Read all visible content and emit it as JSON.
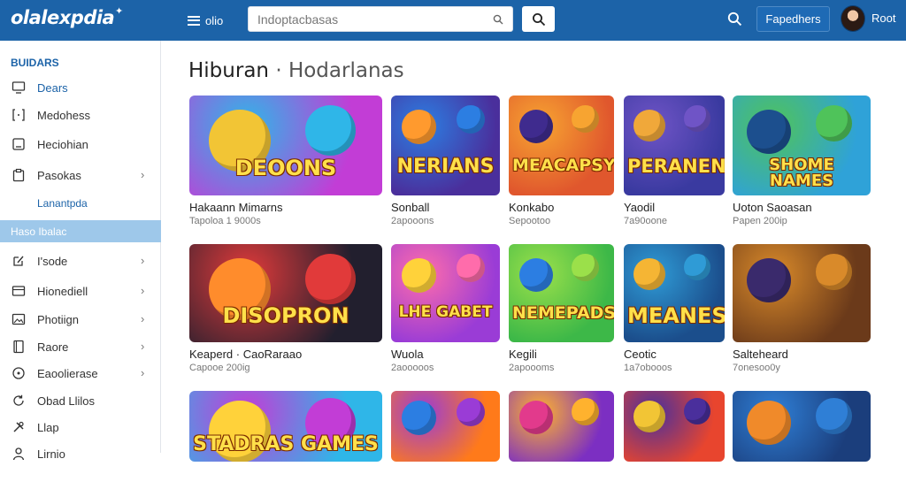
{
  "header": {
    "logo": "olalexpdia",
    "menu_label": "olio",
    "search_placeholder": "Indoptacbasas",
    "favorites_label": "Fapedhers",
    "user_name": "Root"
  },
  "sidebar": {
    "heading": "BUIDARS",
    "items": [
      {
        "label": "Dears",
        "icon": "monitor-icon",
        "chevron": false,
        "blue": true
      },
      {
        "label": "Medohess",
        "icon": "bracket-icon",
        "chevron": false,
        "blue": false
      },
      {
        "label": "Heciohian",
        "icon": "square-icon",
        "chevron": false,
        "blue": false
      },
      {
        "label": "Pasokas",
        "icon": "clipboard-icon",
        "chevron": true,
        "blue": false
      }
    ],
    "sub_item": "Lanantpda",
    "active_item": "Haso Ibalac",
    "items2": [
      {
        "label": "I'sode",
        "icon": "edit-icon",
        "chevron": true
      },
      {
        "label": "Hionediell",
        "icon": "card-icon",
        "chevron": true
      },
      {
        "label": "Photiign",
        "icon": "photo-icon",
        "chevron": true
      },
      {
        "label": "Raore",
        "icon": "book-icon",
        "chevron": true
      },
      {
        "label": "Eaoolierase",
        "icon": "circle-icon",
        "chevron": true
      },
      {
        "label": "Obad Llilos",
        "icon": "refresh-icon",
        "chevron": false
      },
      {
        "label": "Llap",
        "icon": "tools-icon",
        "chevron": false
      },
      {
        "label": "Lirnio",
        "icon": "person-icon",
        "chevron": false
      }
    ]
  },
  "main": {
    "title": "Hiburan",
    "title_sep": "·",
    "subtitle": "Hodarlanas"
  },
  "games": [
    {
      "title": "Hakaann Mimarns",
      "meta": "Tapoloa 1 9000s",
      "art": "DEOONS",
      "colors": [
        "#c23dd6",
        "#2fb6e8",
        "#f2c535"
      ]
    },
    {
      "title": "Sonball",
      "meta": "2apooons",
      "art": "NERIANS",
      "colors": [
        "#4a2f9c",
        "#2c7ee2",
        "#ff9a2e"
      ]
    },
    {
      "title": "Konkabo",
      "meta": "Sepootoo",
      "art": "MEACAPSY",
      "colors": [
        "#e0572d",
        "#f7a431",
        "#3f2b8e"
      ]
    },
    {
      "title": "Yaodil",
      "meta": "7a90oone",
      "art": "PERANEN",
      "colors": [
        "#3a3aa0",
        "#6f54c6",
        "#f0a83a"
      ]
    },
    {
      "title": "Uoton Saoasan",
      "meta": "Papen 200ip",
      "art": "SHOME NAMES",
      "colors": [
        "#2fa2d8",
        "#4fc35a",
        "#1c4f8e"
      ]
    },
    {
      "title": "Keaperd · CaoRaraao",
      "meta": "Capooe 200ig",
      "art": "DISOPRON",
      "colors": [
        "#221f2e",
        "#e13a3a",
        "#ff8c2c"
      ]
    },
    {
      "title": "Wuola",
      "meta": "2aooooos",
      "art": "LHE GABET",
      "colors": [
        "#9a3cd6",
        "#ff6cab",
        "#ffd23a"
      ]
    },
    {
      "title": "Kegili",
      "meta": "2apoooms",
      "art": "NEMEPADS",
      "colors": [
        "#3db848",
        "#9be04a",
        "#2c7ee2"
      ]
    },
    {
      "title": "Ceotic",
      "meta": "1a7obooos",
      "art": "MEANES",
      "colors": [
        "#1b4e8c",
        "#2f9bd6",
        "#f5b534"
      ]
    },
    {
      "title": "Salteheard",
      "meta": "7onesoo0y",
      "art": "",
      "colors": [
        "#6b3a1a",
        "#d98a2a",
        "#3a2a6c"
      ]
    },
    {
      "title": "",
      "meta": "",
      "art": "STADRAS GAMES",
      "colors": [
        "#2fb6e8",
        "#c23dd6",
        "#ffd23a"
      ]
    },
    {
      "title": "",
      "meta": "",
      "art": "",
      "colors": [
        "#ff7a1a",
        "#9a3cd6",
        "#2c7ee2"
      ]
    },
    {
      "title": "",
      "meta": "",
      "art": "",
      "colors": [
        "#7c2fc2",
        "#ffb22e",
        "#e23a8c"
      ]
    },
    {
      "title": "",
      "meta": "",
      "art": "",
      "colors": [
        "#e8452e",
        "#4a2f9c",
        "#f2c535"
      ]
    },
    {
      "title": "",
      "meta": "",
      "art": "",
      "colors": [
        "#1b3e7c",
        "#2f7fd6",
        "#f08a2a"
      ]
    }
  ]
}
